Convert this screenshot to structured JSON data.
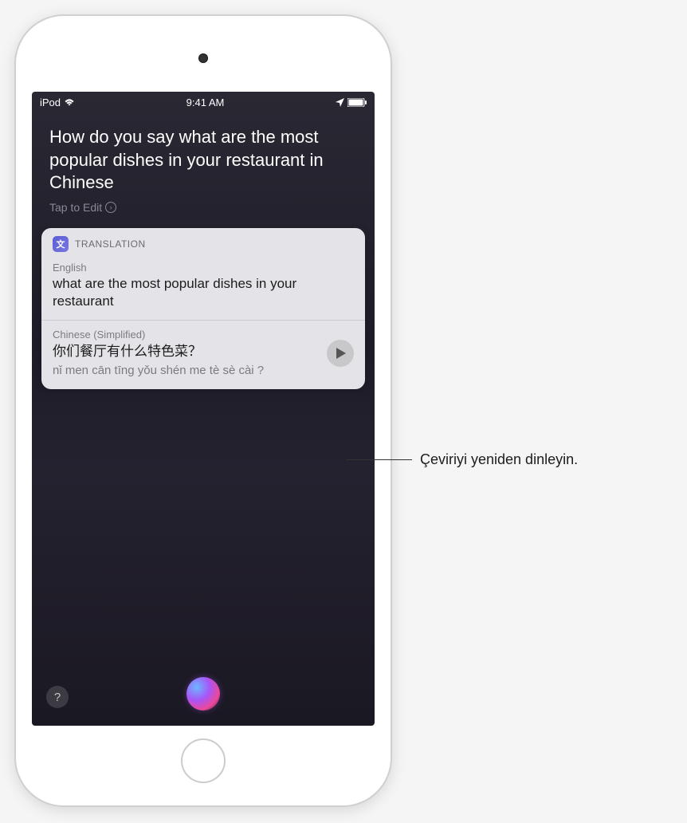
{
  "status_bar": {
    "device": "iPod",
    "time": "9:41 AM"
  },
  "query": {
    "text": "How do you say what are the most popular dishes in your restaurant in Chinese",
    "edit_label": "Tap to Edit"
  },
  "translation": {
    "header_label": "TRANSLATION",
    "source": {
      "lang": "English",
      "text": "what are the most popular dishes in your restaurant"
    },
    "target": {
      "lang": "Chinese (Simplified)",
      "text": "你们餐厅有什么特色菜？",
      "romanization": "nǐ men cān tīng yǒu shén me tè sè cài ?"
    }
  },
  "help": {
    "symbol": "?"
  },
  "callout": {
    "text": "Çeviriyi yeniden dinleyin."
  }
}
